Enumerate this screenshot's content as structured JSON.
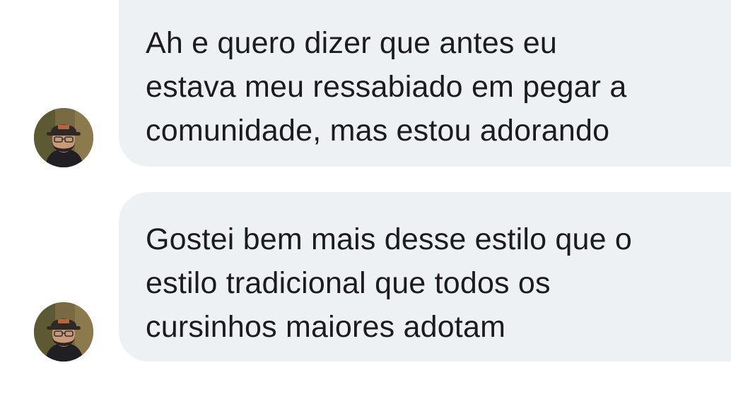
{
  "messages": [
    {
      "sender_avatar": "avatar",
      "text": "Ah e quero dizer que antes eu\nestava meu ressabiado em pegar a\ncomunidade, mas estou adorando"
    },
    {
      "sender_avatar": "avatar",
      "text": "Gostei bem mais desse estilo que o\nestilo tradicional que todos os\ncursinhos maiores adotam"
    }
  ],
  "colors": {
    "bubble_background": "#eef1f3",
    "text": "#1c1c1e",
    "page_background": "#ffffff"
  }
}
